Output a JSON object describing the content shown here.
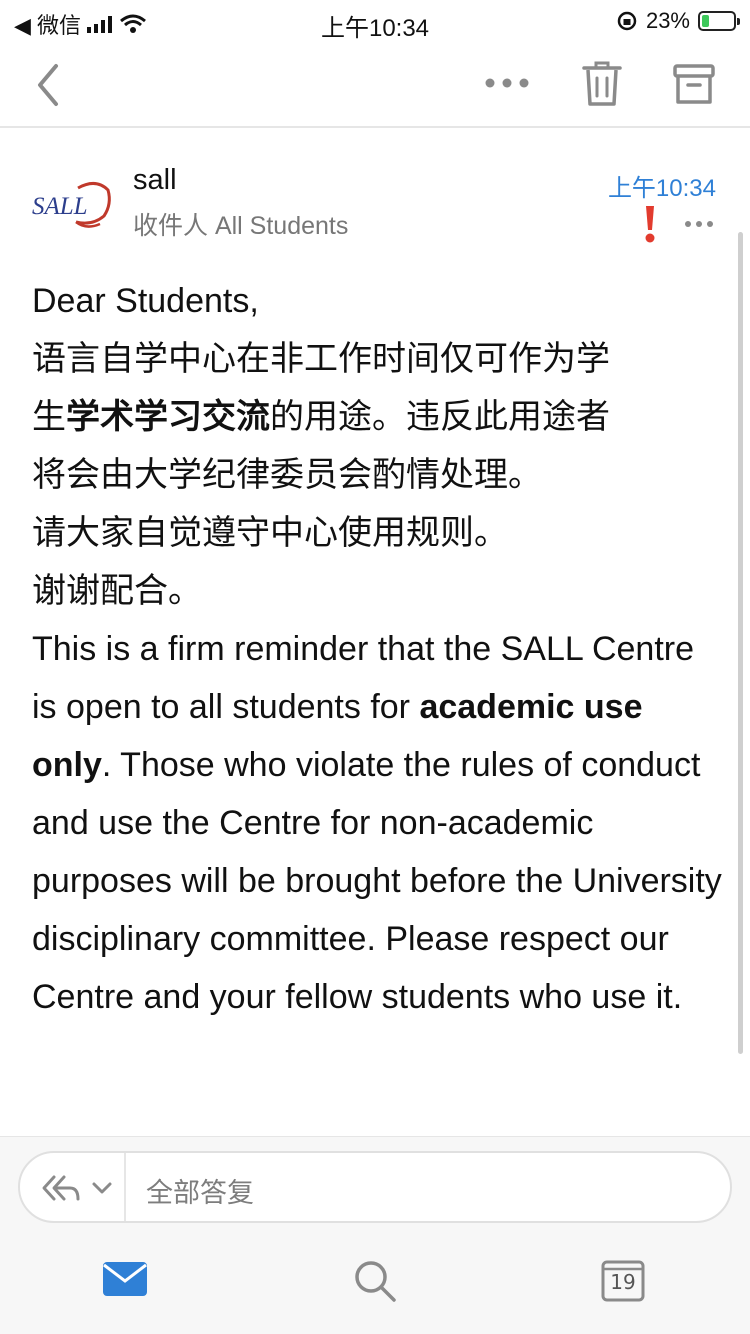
{
  "status_bar": {
    "back_app": "◀ 微信",
    "time": "上午10:34",
    "battery_percent": "23%",
    "battery_level": 0.23
  },
  "toolbar": {
    "back_icon": "chevron-left-icon",
    "more_icon": "ellipsis-icon",
    "delete_icon": "trash-icon",
    "archive_icon": "archive-icon"
  },
  "message": {
    "sender": "sall",
    "recipients": "收件人 All Students",
    "time": "上午10:34",
    "logo_text": "SALL",
    "flag_color": "#e23b2e",
    "body": {
      "greeting": "Dear Students,",
      "cn_line1": "语言自学中心在非工作时间仅可作为学",
      "cn_line2_pre": "生",
      "cn_line2_bold": "学术学习交流",
      "cn_line2_post": "的用途。违反此用途者",
      "cn_line3": "将会由大学纪律委员会酌情处理。",
      "cn_line4": "请大家自觉遵守中心使用规则。",
      "cn_line5": "谢谢配合。",
      "en_pre": "This is a firm reminder that the SALL Centre is open to all students for ",
      "en_bold": "academic use only",
      "en_post": ". Those who violate the rules of conduct and use the Centre for non-academic purposes will be brought before the University disciplinary committee. Please respect our Centre and your fellow students who use it."
    }
  },
  "reply": {
    "placeholder": "全部答复",
    "reply_icon": "reply-all-icon",
    "chevron_icon": "chevron-down-icon"
  },
  "tabbar": {
    "mail_icon": "mail-icon",
    "search_icon": "search-icon",
    "calendar_icon": "calendar-icon",
    "calendar_day": "19"
  },
  "colors": {
    "accent": "#2f80d6",
    "flag": "#e23b2e"
  }
}
